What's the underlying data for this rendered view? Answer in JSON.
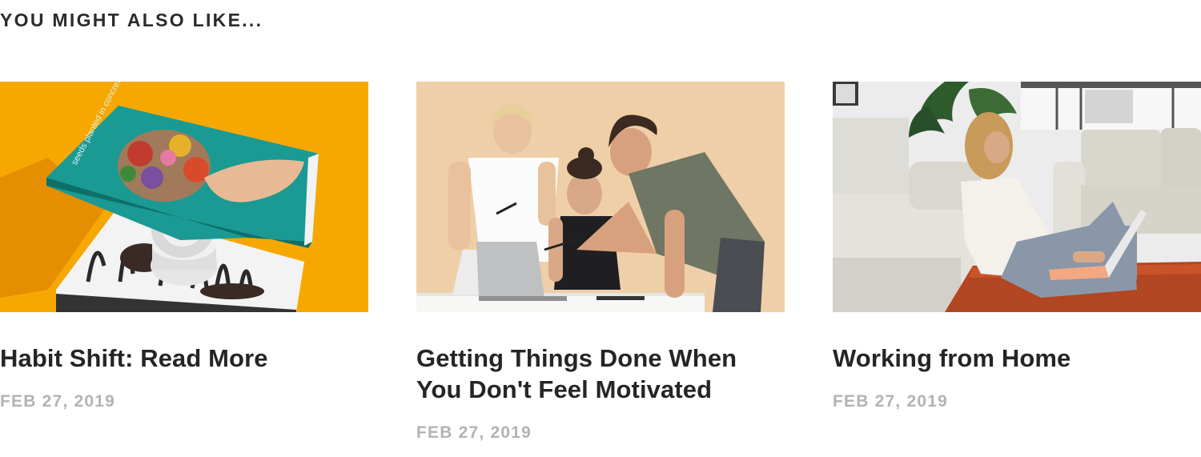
{
  "section": {
    "heading": "YOU MIGHT ALSO LIKE..."
  },
  "cards": [
    {
      "title": "Habit Shift: Read More",
      "date": "FEB 27, 2019",
      "image": "books-on-orange-photo",
      "book_cover_text": "seeds planted in concrete"
    },
    {
      "title": "Getting Things Done When You Don't Feel Motivated",
      "date": "FEB 27, 2019",
      "image": "team-at-laptop-photo"
    },
    {
      "title": "Working from Home",
      "date": "FEB 27, 2019",
      "image": "woman-on-floor-with-laptop-photo"
    }
  ],
  "colors": {
    "heading": "#2b2b2b",
    "title": "#252525",
    "date": "#b3b3b3",
    "card1_bg": "#f7a800",
    "card2_bg": "#efcfa8",
    "card3_bg": "#ececec"
  }
}
